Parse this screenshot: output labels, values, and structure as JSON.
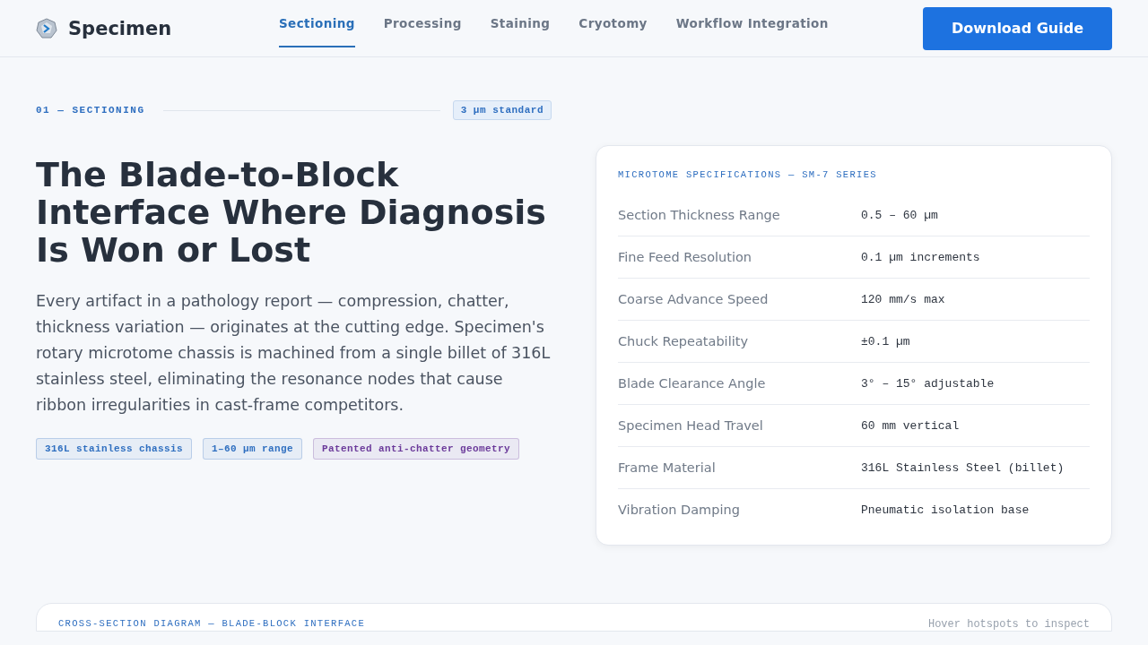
{
  "brand": {
    "name": "Specimen"
  },
  "nav": [
    {
      "label": "Sectioning",
      "selected": true
    },
    {
      "label": "Processing",
      "selected": false
    },
    {
      "label": "Staining",
      "selected": false
    },
    {
      "label": "Cryotomy",
      "selected": false
    },
    {
      "label": "Workflow Integration",
      "selected": false
    }
  ],
  "cta": "Download Guide",
  "section": {
    "label": "01 — SECTIONING",
    "badge": "3 µm standard"
  },
  "heading": "The Blade-to-Block Interface Where Diagnosis Is Won or Lost",
  "body": "Every artifact in a pathology report — compression, chatter, thickness variation — originates at the cutting edge. Specimen's rotary microtome chassis is machined from a single billet of 316L stainless steel, eliminating the resonance nodes that cause ribbon irregularities in cast-frame competitors.",
  "tags": [
    {
      "label": "316L stainless chassis",
      "color": "#2f6fc0"
    },
    {
      "label": "1–60 µm range",
      "color": "#2f6fc0"
    },
    {
      "label": "Patented anti-chatter geometry",
      "color": "#6b3a9a"
    }
  ],
  "specs": {
    "title": "MICROTOME SPECIFICATIONS — SM-7 SERIES",
    "rows": [
      {
        "name": "Section Thickness Range",
        "value": "0.5 – 60 µm"
      },
      {
        "name": "Fine Feed Resolution",
        "value": "0.1 µm increments"
      },
      {
        "name": "Coarse Advance Speed",
        "value": "120 mm/s max"
      },
      {
        "name": "Chuck Repeatability",
        "value": "±0.1 µm"
      },
      {
        "name": "Blade Clearance Angle",
        "value": "3° – 15° adjustable"
      },
      {
        "name": "Specimen Head Travel",
        "value": "60 mm vertical"
      },
      {
        "name": "Frame Material",
        "value": "316L Stainless Steel (billet)"
      },
      {
        "name": "Vibration Damping",
        "value": "Pneumatic isolation base"
      }
    ]
  },
  "diagram": {
    "title": "CROSS-SECTION DIAGRAM — BLADE-BLOCK INTERFACE",
    "hint": "Hover hotspots to inspect"
  }
}
